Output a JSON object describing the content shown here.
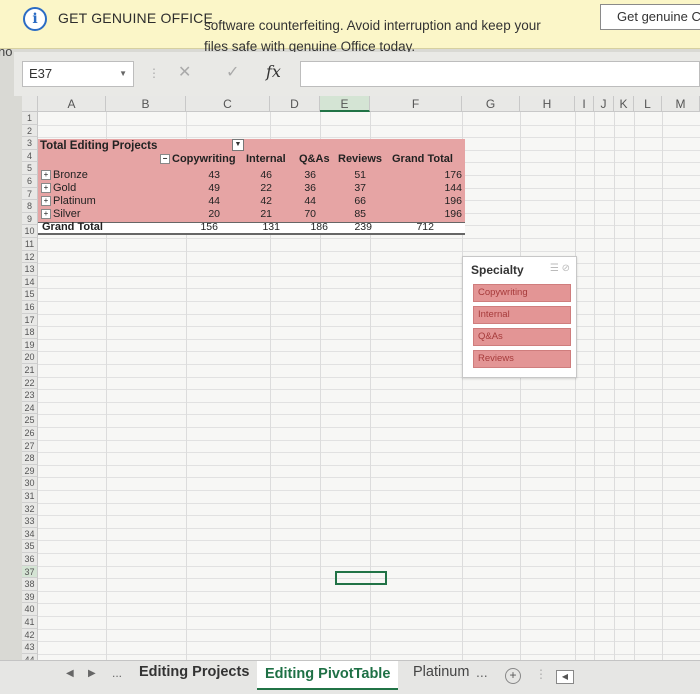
{
  "infobar": {
    "title": "GET GENUINE OFFICE",
    "message_line1": "software counterfeiting. Avoid interruption and keep your",
    "message_line2": "files safe with genuine Office today.",
    "button": "Get genuine C"
  },
  "edge_label": "no",
  "formula_bar": {
    "name_box": "E37",
    "formula": ""
  },
  "columns": [
    "A",
    "B",
    "C",
    "D",
    "E",
    "F",
    "G",
    "H",
    "I",
    "J",
    "K",
    "L",
    "M"
  ],
  "selected_column": "E",
  "rows": [
    "1",
    "2",
    "3",
    "4",
    "5",
    "6",
    "7",
    "8",
    "9",
    "10",
    "11",
    "12",
    "13",
    "14",
    "15",
    "16",
    "17",
    "18",
    "19",
    "20",
    "21",
    "22",
    "23",
    "24",
    "25",
    "26",
    "27",
    "28",
    "29",
    "30",
    "31",
    "32",
    "33",
    "34",
    "35",
    "36",
    "37",
    "38",
    "39",
    "40",
    "41",
    "42",
    "43",
    "44"
  ],
  "selected_row": "37",
  "pivot": {
    "title": "Total Editing Projects",
    "headers": [
      "Copywriting",
      "Internal",
      "Q&As",
      "Reviews",
      "Grand Total"
    ],
    "rows": [
      {
        "label": "Bronze",
        "values": [
          "43",
          "46",
          "36",
          "51",
          "176"
        ]
      },
      {
        "label": "Gold",
        "values": [
          "49",
          "22",
          "36",
          "37",
          "144"
        ]
      },
      {
        "label": "Platinum",
        "values": [
          "44",
          "42",
          "44",
          "66",
          "196"
        ]
      },
      {
        "label": "Silver",
        "values": [
          "20",
          "21",
          "70",
          "85",
          "196"
        ]
      }
    ],
    "grand_total": {
      "label": "Grand Total",
      "values": [
        "156",
        "131",
        "186",
        "239",
        "712"
      ]
    }
  },
  "slicer": {
    "title": "Specialty",
    "items": [
      "Copywriting",
      "Internal",
      "Q&As",
      "Reviews"
    ]
  },
  "tabs": {
    "nav_prev": "◀",
    "nav_next": "▶",
    "ellipsis": "...",
    "sheets": [
      "Editing Projects",
      "Editing PivotTable",
      "Platinum"
    ],
    "active": "Editing PivotTable",
    "more": "...",
    "add": "+"
  }
}
